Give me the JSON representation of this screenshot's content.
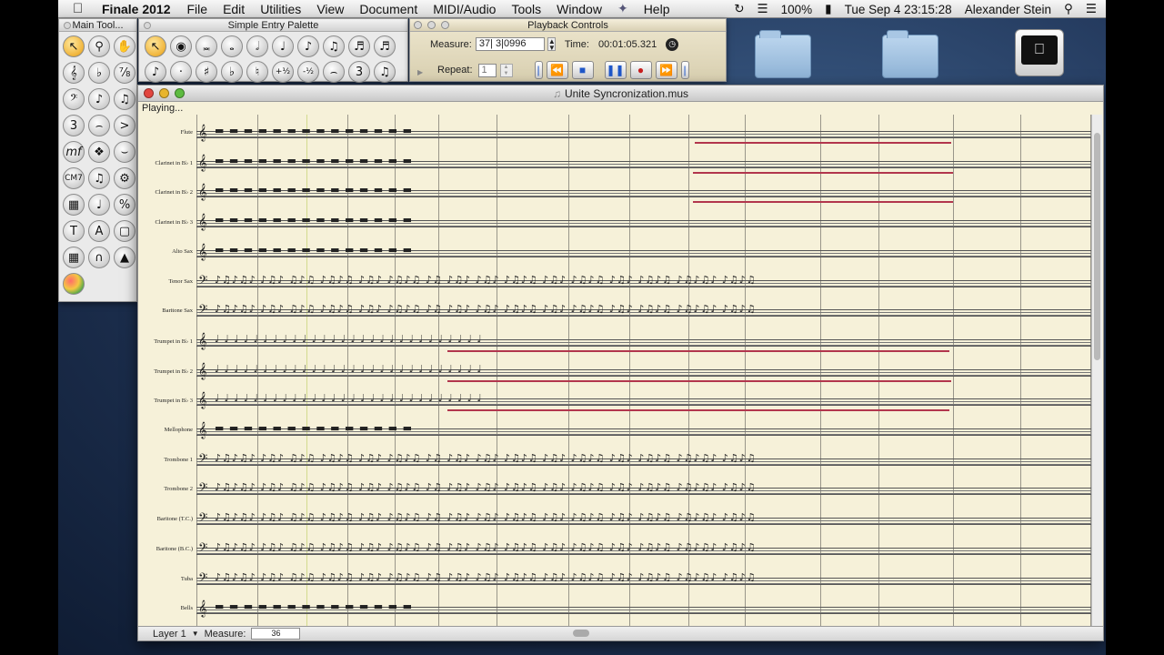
{
  "menubar": {
    "app_name": "Finale 2012",
    "items": [
      "File",
      "Edit",
      "Utilities",
      "View",
      "Document",
      "MIDI/Audio",
      "Tools",
      "Window",
      "Help"
    ],
    "battery": "100%",
    "datetime": "Tue Sep 4  23:15:28",
    "user": "Alexander Stein"
  },
  "main_tool": {
    "title": "Main Tool..."
  },
  "simple_entry": {
    "title": "Simple Entry Palette"
  },
  "playback": {
    "title": "Playback Controls",
    "measure_label": "Measure:",
    "measure_value": "37| 3|0996",
    "time_label": "Time:",
    "time_value": "00:01:05.321",
    "repeat_label": "Repeat:",
    "repeat_value": "1"
  },
  "score": {
    "title": "Unite Syncronization.mus",
    "status": "Playing...",
    "layer": "Layer 1",
    "measure_label": "Measure:",
    "measure_value": "36",
    "instruments": [
      "Flute",
      "Clarinet in B♭ 1",
      "Clarinet in B♭ 2",
      "Clarinet in B♭ 3",
      "Alto Sax",
      "Tenor Sax",
      "Baritone Sax",
      "Trumpet in B♭ 1",
      "Trumpet in B♭ 2",
      "Trumpet in B♭ 3",
      "Mellophone",
      "Trombone 1",
      "Trombone 2",
      "Baritone (T.C.)",
      "Baritone (B.C.)",
      "Tuba",
      "Bells"
    ]
  },
  "colors": {
    "paper": "#f6f1d9",
    "red_line": "#b2364d",
    "accent": "#1f57c8"
  }
}
